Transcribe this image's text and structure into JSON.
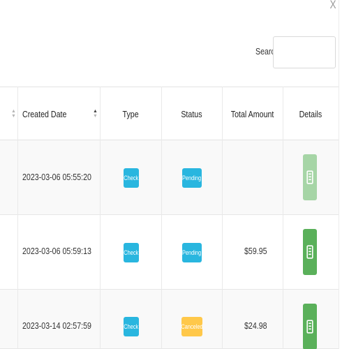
{
  "modal": {
    "close_label": "X",
    "search_label": "Search",
    "search_value": ""
  },
  "table": {
    "headers": {
      "created_date": "Created Date",
      "type": "Type",
      "status": "Status",
      "total_amount": "Total Amount",
      "details": "Details"
    },
    "rows": [
      {
        "created_date": "2023-03-06 05:55:20",
        "type": "Check",
        "status": "Pending",
        "status_color": "#29b6df",
        "total_amount": "",
        "details_icon": "receipt-icon"
      },
      {
        "created_date": "2023-03-06 05:59:13",
        "type": "Check",
        "status": "Pending",
        "status_color": "#29b6df",
        "total_amount": "$59.95",
        "details_icon": "receipt-icon"
      },
      {
        "created_date": "2023-03-14 02:57:59",
        "type": "Check",
        "status": "Canceled",
        "status_color": "#ffc84a",
        "total_amount": "$24.98",
        "details_icon": "receipt-icon"
      }
    ]
  },
  "colors": {
    "info": "#29b6df",
    "warning": "#ffc84a",
    "success": "#5ab05a",
    "success_light": "#a6d5a6"
  }
}
